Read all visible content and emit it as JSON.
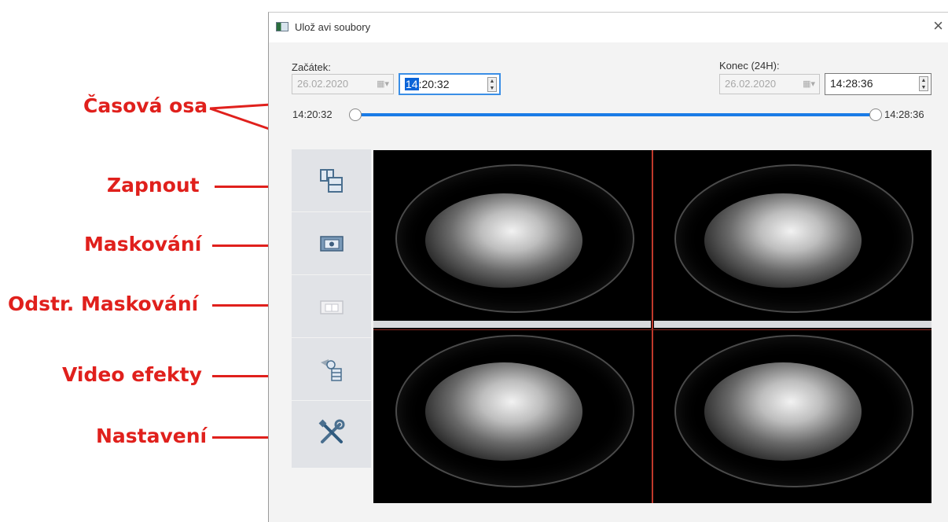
{
  "annotations": {
    "timeline": "Časová osa",
    "zoom": "Zapnout",
    "mask": "Maskování",
    "unmask": "Odstr. Maskování",
    "effects": "Video efekty",
    "settings": "Nastavení"
  },
  "dialog": {
    "title": "Ulož avi soubory",
    "close": "×",
    "start_label": "Začátek:",
    "start_date": "26.02.2020",
    "start_time_hour": "14",
    "start_time_rest": ":20:32",
    "end_label": "Konec (24H):",
    "end_date": "26.02.2020",
    "end_time": "14:28:36",
    "slider_start": "14:20:32",
    "slider_end": "14:28:36",
    "slider_range": [
      0,
      1
    ]
  },
  "toolbar": {
    "buttons": [
      {
        "name": "zoom",
        "icon": "zoom-layout-icon"
      },
      {
        "name": "mask",
        "icon": "mask-icon"
      },
      {
        "name": "unmask",
        "icon": "unmask-icon"
      },
      {
        "name": "video-effects",
        "icon": "video-effects-icon"
      },
      {
        "name": "settings",
        "icon": "tools-icon"
      }
    ]
  },
  "colors": {
    "annotation": "#e0201c",
    "slider": "#1a7be6",
    "toolbar_bg": "#e1e3e7"
  }
}
